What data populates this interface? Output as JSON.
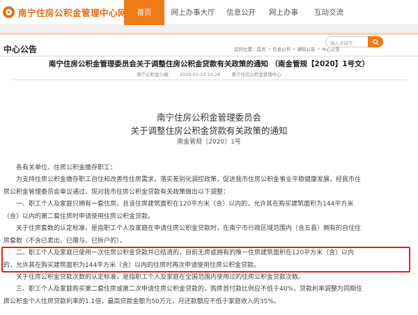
{
  "site": {
    "logo_text": "南宁住房公积金管理中心网站"
  },
  "nav": {
    "items": [
      "首页",
      "网上办事大厅",
      "信息公开",
      "网上办事",
      "互动交流"
    ],
    "active_index": 0
  },
  "search": {
    "placeholder": "输入关键字",
    "icon": "search-icon"
  },
  "section": {
    "title": "中心公告"
  },
  "breadcrumb": [
    "您的位置：首页",
    "信息公开",
    "通知公告",
    "中心公告"
  ],
  "article": {
    "heading": "南宁住房公积金管理委员会关于调整住房公积金贷款有关政策的通知 （南金管规【2020】1号文）",
    "date": "2020-02-23 10:26",
    "author": "南宁公积金小编",
    "source": "南宁住房公积金管理中心",
    "notice_title_1": "南宁住房公积金管理委员会",
    "notice_title_2": "关于调整住房公积金贷款有关政策的通知",
    "doc_number": "南金管规〔2020〕1号",
    "paragraphs": [
      [
        "各有关单位、住房公积金缴存职工："
      ],
      [
        "为支持住房公积金缴存职工自住和改善性住房需求，落实差别化调控政策，促进我市住房公积金事业平稳健康发展，经我市住",
        "房公积金管理委员会审议通过，现对我市住房公积金贷款有关政策做出以下调整："
      ],
      [
        "一、职工个人及家庭只拥有一套住房，且该住房建筑面积在120平方米（含）以内的，允许其在购买建筑面积为144平方米",
        "（含）以内的第二套住房时申请使用住房公积金贷款。"
      ],
      [
        "关于住房套数的认定标准，是指职工个人及家庭在申请住房公积金贷款时，在南宁市行政区域范围内（含五县）拥有的自住住",
        "房套数（不含已卖出、已赠与、已拆户的）。"
      ],
      [
        "二、职工个人及家庭已使用一次住房公积金贷款并已结清的，目前无房或拥有的唯一住房建筑面积在120平方米（含）以内",
        "的，允许其在购买建筑面积为144平方米（含）以内的住房时再次申请使用住房公积金贷款。"
      ],
      [
        "关于住房公积金贷款次数的认定标准，是指职工个人及家庭在全国范围内使用过的住房公积金贷款次数。"
      ],
      [
        "三、职工个人及家庭购买第二套住房或第二次申请住房公积金贷款的，购房首付款比例应不低于40%，贷款利率调整为同期住",
        "房公积金个人住房贷款利率的1.1倍，最高贷款金额为50万元，月还款额应不低于家庭收入的35%。"
      ]
    ]
  },
  "highlight": {
    "color": "#e01f1f"
  },
  "colors": {
    "accent": "#ef7a18",
    "logo": "#e26c12"
  }
}
